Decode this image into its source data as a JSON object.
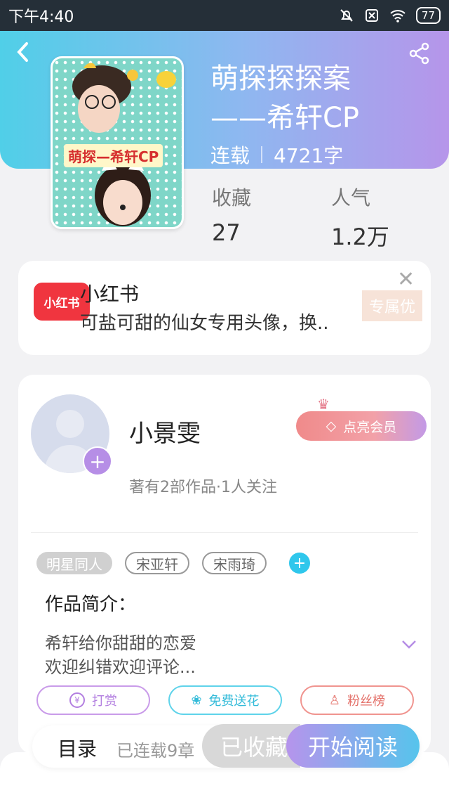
{
  "status_bar": {
    "time": "下午4:40",
    "battery": "77"
  },
  "book": {
    "title_line1": "萌探探探案",
    "title_line2": "——希轩CP",
    "status": "连载",
    "word_count": "4721字",
    "cover_text": "萌探—希轩CP",
    "stats": [
      {
        "label": "收藏",
        "value": "27"
      },
      {
        "label": "人气",
        "value": "1.2万"
      }
    ]
  },
  "ad": {
    "logo_text": "小红书",
    "title": "小红书",
    "desc": "可盐可甜的仙女专用头像，换..",
    "badge": "专属优"
  },
  "author": {
    "name": "小景雯",
    "sub": "著有2部作品·1人关注",
    "vip_label": "点亮会员"
  },
  "tags": {
    "category": "明星同人",
    "items": [
      "宋亚轩",
      "宋雨琦"
    ]
  },
  "intro": {
    "heading": "作品简介：",
    "line1": "希轩给你甜甜的恋爱",
    "line2": "欢迎纠错欢迎评论..."
  },
  "actions": {
    "tip": "打赏",
    "flower": "免费送花",
    "fans": "粉丝榜"
  },
  "bottom": {
    "toc": "目录",
    "toc_sub": "已连载9章",
    "fav": "已收藏",
    "read": "开始阅读"
  },
  "colors": {
    "accent_blue": "#50cfe8",
    "accent_purple": "#b68ee6"
  }
}
